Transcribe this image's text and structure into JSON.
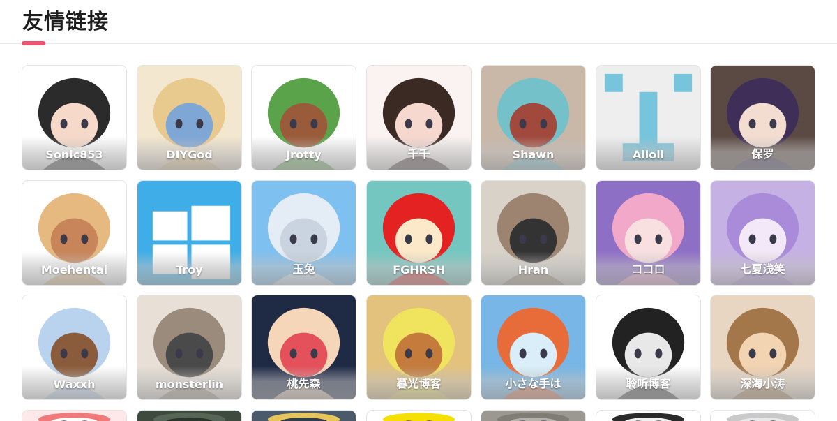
{
  "page": {
    "title": "友情链接",
    "accent": "#f0506e"
  },
  "friends": [
    {
      "name": "Sonic853",
      "icon": "avatar-black-cap-boy",
      "colors": [
        "#ffffff",
        "#2b2b2b",
        "#f6d9c8"
      ]
    },
    {
      "name": "DIYGod",
      "icon": "avatar-anime-blue-eyes",
      "colors": [
        "#f4e7cf",
        "#e8c98e",
        "#7ea7d6"
      ]
    },
    {
      "name": "Jrotty",
      "icon": "avatar-frog-hood",
      "colors": [
        "#ffffff",
        "#5ba34a",
        "#9a5b3a"
      ]
    },
    {
      "name": "千千",
      "icon": "avatar-anime-girl-laughing",
      "colors": [
        "#faf3f2",
        "#3b2a24",
        "#f6d8cf"
      ]
    },
    {
      "name": "Shawn",
      "icon": "avatar-teal-hair-hat",
      "colors": [
        "#c9b7a8",
        "#74c1c9",
        "#a1493d"
      ]
    },
    {
      "name": "Ailoli",
      "icon": "avatar-pixel-face",
      "colors": [
        "#eeeeee",
        "#76c5dc",
        "#76c5dc"
      ]
    },
    {
      "name": "保罗",
      "icon": "avatar-purple-hair-chibi",
      "colors": [
        "#5b4a44",
        "#3f2f58",
        "#f3dcd0"
      ]
    },
    {
      "name": "Moehentai",
      "icon": "avatar-framed-anime-girl",
      "colors": [
        "#ffffff",
        "#e5b980",
        "#c9855a"
      ]
    },
    {
      "name": "Troy",
      "icon": "avatar-windows-logo",
      "colors": [
        "#3faee8",
        "#ffffff",
        "#2e95cf"
      ]
    },
    {
      "name": "玉兔",
      "icon": "avatar-anime-girl-sky",
      "colors": [
        "#7ec0f0",
        "#e4ecf5",
        "#c9d4e0"
      ]
    },
    {
      "name": "FGHRSH",
      "icon": "avatar-red-fox",
      "colors": [
        "#74c7c0",
        "#e52222",
        "#fbe9c9"
      ]
    },
    {
      "name": "Hran",
      "icon": "avatar-cat-bow",
      "colors": [
        "#d8d2c8",
        "#9c8470",
        "#333333"
      ]
    },
    {
      "name": "ココロ",
      "icon": "avatar-pink-hair-girl",
      "colors": [
        "#8e6fc6",
        "#f2a8c8",
        "#f8e0e0"
      ]
    },
    {
      "name": "七夏浅笑",
      "icon": "avatar-lavender-hair-girl",
      "colors": [
        "#c6b1e5",
        "#a98bd9",
        "#f3e8f7"
      ]
    },
    {
      "name": "Waxxh",
      "icon": "avatar-chibi-circle",
      "colors": [
        "#ffffff",
        "#b9d3ef",
        "#8a5c3b"
      ]
    },
    {
      "name": "monsterlin",
      "icon": "avatar-cat-photo",
      "colors": [
        "#e8dfd6",
        "#9b8b7c",
        "#4a4a4a"
      ]
    },
    {
      "name": "桃先森",
      "icon": "avatar-anime-boy-tongue",
      "colors": [
        "#1f2a45",
        "#f6d6b8",
        "#e4515b"
      ]
    },
    {
      "name": "暮光博客",
      "icon": "avatar-cartoon-boy",
      "colors": [
        "#e3c27e",
        "#f0e35e",
        "#c47b3b"
      ]
    },
    {
      "name": "小さな手は",
      "icon": "avatar-anime-sea",
      "colors": [
        "#77b6e6",
        "#e86b3a",
        "#d9eef8"
      ]
    },
    {
      "name": "聆听博客",
      "icon": "avatar-headphones-figure",
      "colors": [
        "#ffffff",
        "#222222",
        "#e8e8e8"
      ]
    },
    {
      "name": "深海小涛",
      "icon": "avatar-brown-hair-boy",
      "colors": [
        "#e8d6c2",
        "#a3774a",
        "#f2d3b2"
      ]
    },
    {
      "name": "",
      "icon": "avatar-partial-1",
      "colors": [
        "#fde8ea",
        "#f07a7a",
        "#ffffff"
      ]
    },
    {
      "name": "",
      "icon": "avatar-partial-2",
      "colors": [
        "#3e4a3e",
        "#566656",
        "#2c352c"
      ]
    },
    {
      "name": "",
      "icon": "avatar-partial-3",
      "colors": [
        "#4a5a6a",
        "#e6c65a",
        "#2f3c4a"
      ]
    },
    {
      "name": "",
      "icon": "avatar-partial-4",
      "colors": [
        "#ffffff",
        "#f5e000",
        "#f5e000"
      ]
    },
    {
      "name": "",
      "icon": "avatar-partial-5",
      "colors": [
        "#9a9890",
        "#7f7d76",
        "#b4b2aa"
      ]
    },
    {
      "name": "",
      "icon": "avatar-partial-6",
      "colors": [
        "#ffffff",
        "#2a2a2a",
        "#f1f1f1"
      ]
    },
    {
      "name": "",
      "icon": "avatar-partial-7",
      "colors": [
        "#ffffff",
        "#c9c9c9",
        "#e8e8e8"
      ]
    }
  ]
}
